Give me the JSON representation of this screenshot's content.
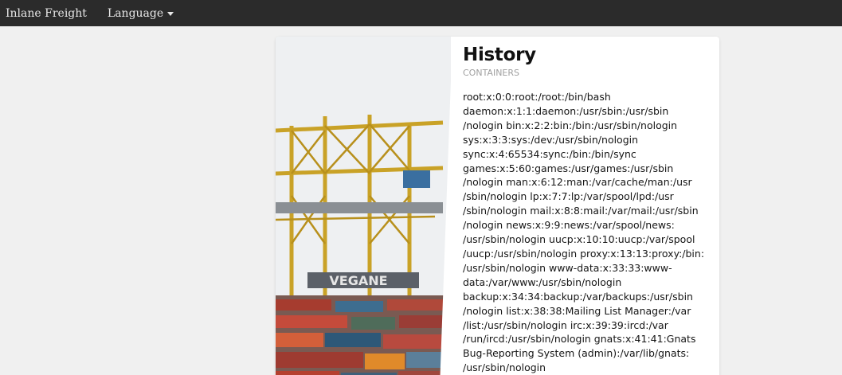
{
  "navbar": {
    "brand": "Inlane Freight",
    "language_label": "Language"
  },
  "card": {
    "title": "History",
    "subtitle": "CONTAINERS",
    "text": "root:x:0:0:root:/root:/bin/bash\ndaemon:x:1:1:daemon:/usr/sbin:/usr/sbin\n/nologin bin:x:2:2:bin:/bin:/usr/sbin/nologin\nsys:x:3:3:sys:/dev:/usr/sbin/nologin\nsync:x:4:65534:sync:/bin:/bin/sync\ngames:x:5:60:games:/usr/games:/usr/sbin\n/nologin man:x:6:12:man:/var/cache/man:/usr\n/sbin/nologin lp:x:7:7:lp:/var/spool/lpd:/usr\n/sbin/nologin mail:x:8:8:mail:/var/mail:/usr/sbin\n/nologin news:x:9:9:news:/var/spool/news:\n/usr/sbin/nologin uucp:x:10:10:uucp:/var/spool\n/uucp:/usr/sbin/nologin proxy:x:13:13:proxy:/bin:\n/usr/sbin/nologin www-data:x:33:33:www-\ndata:/var/www:/usr/sbin/nologin\nbackup:x:34:34:backup:/var/backups:/usr/sbin\n/nologin list:x:38:38:Mailing List Manager:/var\n/list:/usr/sbin/nologin irc:x:39:39:ircd:/var\n/run/ircd:/usr/sbin/nologin gnats:x:41:41:Gnats\nBug-Reporting System (admin):/var/lib/gnats:\n/usr/sbin/nologin",
    "image_text": "VEGANE"
  }
}
